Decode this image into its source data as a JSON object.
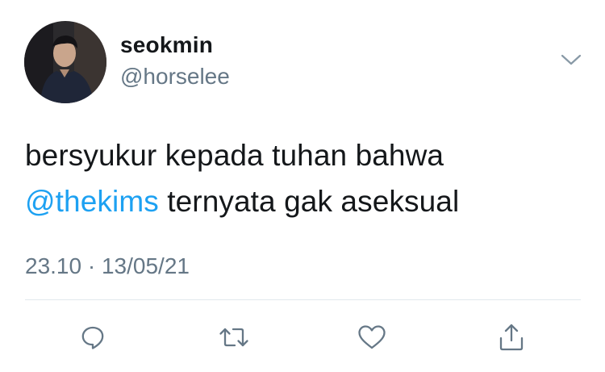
{
  "user": {
    "display_name": "seokmin",
    "handle": "@horselee",
    "avatar": "profile-photo"
  },
  "tweet": {
    "text_before": "bersyukur kepada tuhan bahwa",
    "mention": "@thekims",
    "text_after": " ternyata gak aseksual"
  },
  "meta": {
    "time": "23.10",
    "separator": " · ",
    "date": "13/05/21"
  },
  "icons": {
    "menu": "chevron-down-icon",
    "reply": "reply-icon",
    "retweet": "retweet-icon",
    "like": "heart-icon",
    "share": "share-icon"
  },
  "colors": {
    "text": "#14171a",
    "secondary": "#657786",
    "mention": "#1da1f2",
    "divider": "#e1e8ed"
  }
}
